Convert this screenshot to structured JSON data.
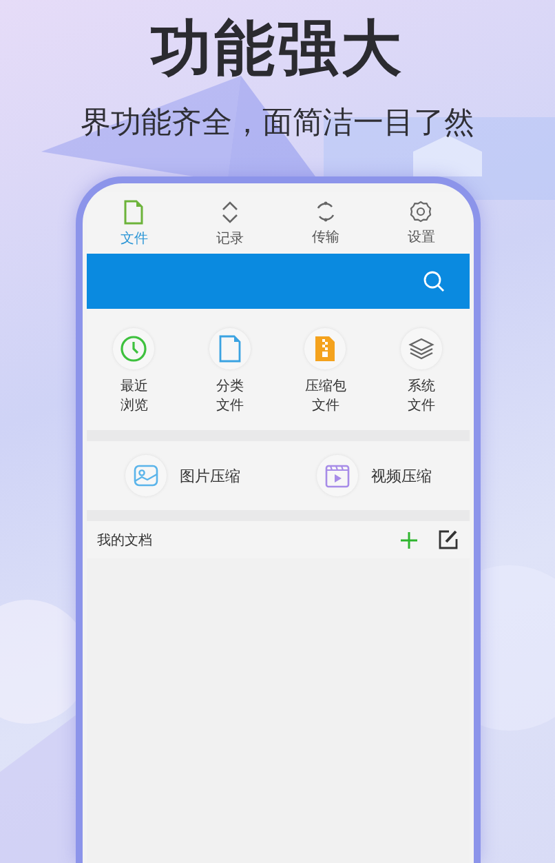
{
  "headline": "功能强大",
  "subtitle": "界功能齐全，面简洁一目了然",
  "tabs": [
    {
      "label": "文件",
      "selected": true
    },
    {
      "label": "记录",
      "selected": false
    },
    {
      "label": "传输",
      "selected": false
    },
    {
      "label": "设置",
      "selected": false
    }
  ],
  "categories": [
    {
      "lines": [
        "最近",
        "浏览"
      ]
    },
    {
      "lines": [
        "分类",
        "文件"
      ]
    },
    {
      "lines": [
        "压缩包",
        "文件"
      ]
    },
    {
      "lines": [
        "系统",
        "文件"
      ]
    }
  ],
  "tools": [
    {
      "label": "图片压缩"
    },
    {
      "label": "视频压缩"
    }
  ],
  "documents": {
    "title": "我的文档"
  }
}
